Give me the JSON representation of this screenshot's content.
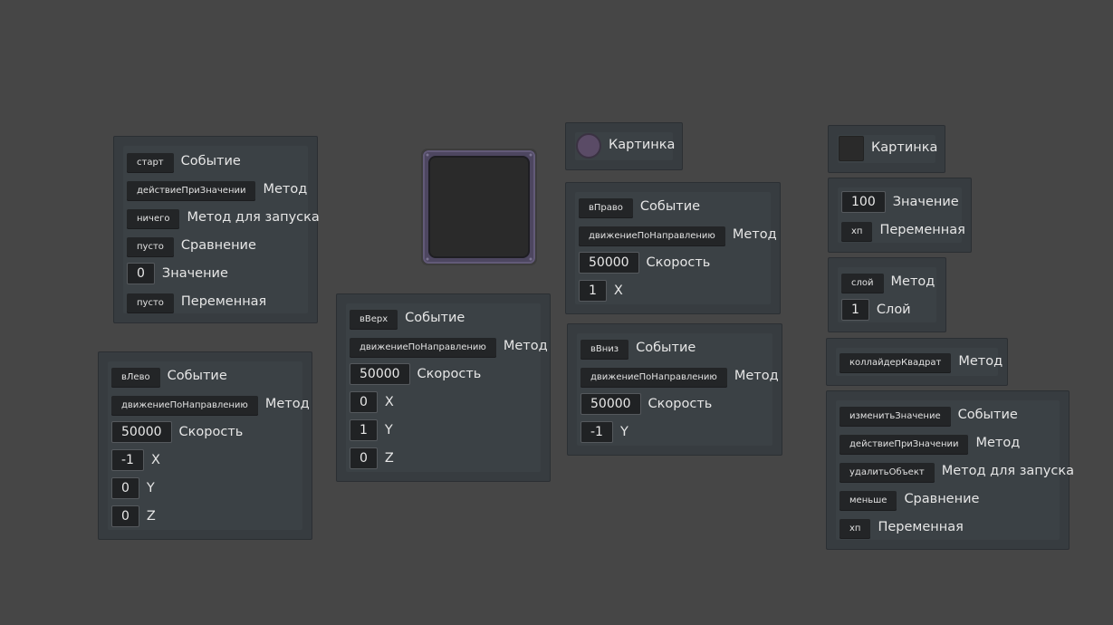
{
  "panel_start": {
    "rows": [
      {
        "chip": "старт",
        "label": "Событие"
      },
      {
        "chip": "действиеПриЗначении",
        "label": "Метод"
      },
      {
        "chip": "ничего",
        "label": "Метод для запуска"
      },
      {
        "chip": "пусто",
        "label": "Сравнение"
      },
      {
        "num": "0",
        "label": "Значение"
      },
      {
        "chip": "пусто",
        "label": "Переменная"
      }
    ]
  },
  "panel_left": {
    "rows": [
      {
        "chip": "вЛево",
        "label": "Событие"
      },
      {
        "chip": "движениеПоНаправлению",
        "label": "Метод"
      },
      {
        "num": "50000",
        "label": "Скорость"
      },
      {
        "num": "-1",
        "label": "X"
      },
      {
        "num": "0",
        "label": "Y"
      },
      {
        "num": "0",
        "label": "Z"
      }
    ]
  },
  "panel_up": {
    "rows": [
      {
        "chip": "вВерх",
        "label": "Событие"
      },
      {
        "chip": "движениеПоНаправлению",
        "label": "Метод"
      },
      {
        "num": "50000",
        "label": "Скорость"
      },
      {
        "num": "0",
        "label": "X"
      },
      {
        "num": "1",
        "label": "Y"
      },
      {
        "num": "0",
        "label": "Z"
      }
    ]
  },
  "image_panel_1": {
    "label": "Картинка"
  },
  "panel_right": {
    "rows": [
      {
        "chip": "вПраво",
        "label": "Событие"
      },
      {
        "chip": "движениеПоНаправлению",
        "label": "Метод"
      },
      {
        "num": "50000",
        "label": "Скорость"
      },
      {
        "num": "1",
        "label": "X"
      }
    ]
  },
  "panel_down": {
    "rows": [
      {
        "chip": "вВниз",
        "label": "Событие"
      },
      {
        "chip": "движениеПоНаправлению",
        "label": "Метод"
      },
      {
        "num": "50000",
        "label": "Скорость"
      },
      {
        "num": "-1",
        "label": "Y"
      }
    ]
  },
  "image_panel_2": {
    "label": "Картинка"
  },
  "panel_value": {
    "rows": [
      {
        "num": "100",
        "label": "Значение"
      },
      {
        "chip": "хп",
        "label": "Переменная"
      }
    ]
  },
  "panel_layer": {
    "rows": [
      {
        "chip": "слой",
        "label": "Метод"
      },
      {
        "num": "1",
        "label": "Слой"
      }
    ]
  },
  "panel_collider": {
    "rows": [
      {
        "chip": "коллайдерКвадрат",
        "label": "Метод"
      }
    ]
  },
  "panel_change": {
    "rows": [
      {
        "chip": "изменитьЗначение",
        "label": "Событие"
      },
      {
        "chip": "действиеПриЗначении",
        "label": "Метод"
      },
      {
        "chip": "удалитьОбъект",
        "label": "Метод для запуска"
      },
      {
        "chip": "меньше",
        "label": "Сравнение"
      },
      {
        "chip": "хп",
        "label": "Переменная"
      }
    ]
  },
  "colors": {
    "background": "#464646",
    "panel": "#373c40",
    "chip": "#232527",
    "sprite_frame": "#4d4660",
    "sprite_fill": "#2a2a2a",
    "circle_swatch": "#5a4b66"
  }
}
